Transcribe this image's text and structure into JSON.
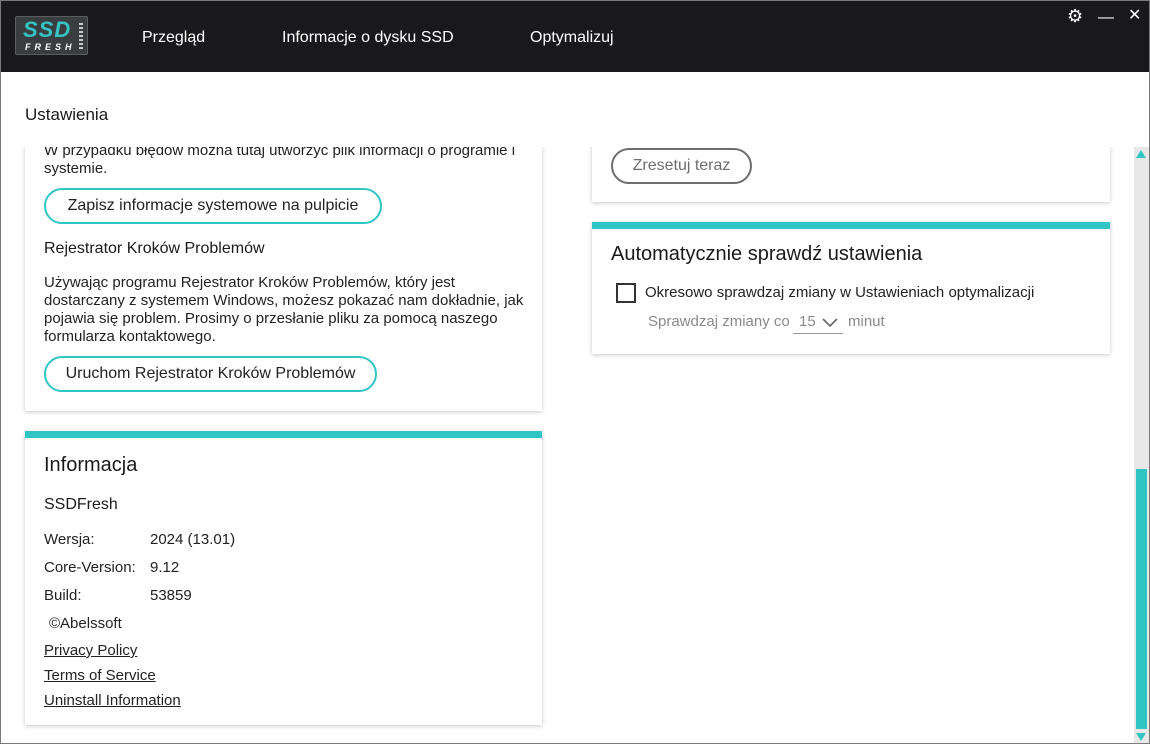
{
  "app": {
    "logo_main": "SSD",
    "logo_sub": "FRESH"
  },
  "nav": {
    "items": [
      {
        "label": "Przegląd"
      },
      {
        "label": "Informacje o dysku SSD"
      },
      {
        "label": "Optymalizuj"
      }
    ]
  },
  "window_controls": {
    "settings": "⚙",
    "minimize": "—",
    "close": "✕"
  },
  "page": {
    "title": "Ustawienia"
  },
  "support_card": {
    "intro_text": "W przypadku błędów można tutaj utworzyć plik informacji o programie i systemie.",
    "save_button": "Zapisz informacje systemowe na pulpicie",
    "psr_heading": "Rejestrator Kroków Problemów",
    "psr_text": "Używając programu Rejestrator Kroków Problemów, który jest dostarczany z systemem Windows, możesz pokazać nam dokładnie, jak pojawia się problem. Prosimy o przesłanie pliku za pomocą naszego formularza kontaktowego.",
    "psr_button": "Uruchom Rejestrator Kroków Problemów"
  },
  "info_card": {
    "title": "Informacja",
    "product": "SSDFresh",
    "rows": [
      {
        "label": "Wersja:",
        "value": "2024 (13.01)"
      },
      {
        "label": "Core-Version:",
        "value": "9.12"
      },
      {
        "label": "Build:",
        "value": "53859"
      }
    ],
    "copyright": "©Abelssoft",
    "links": [
      "Privacy Policy",
      "Terms of Service",
      "Uninstall Information"
    ]
  },
  "reset_card": {
    "button": "Zresetuj teraz"
  },
  "auto_check_card": {
    "title": "Automatycznie sprawdź ustawienia",
    "checkbox_label": "Okresowo sprawdzaj zmiany w Ustawieniach optymalizacji",
    "checked": false,
    "interval_prefix": "Sprawdzaj zmiany co",
    "interval_value": "15",
    "interval_suffix": "minut"
  },
  "colors": {
    "accent": "#30c5c5",
    "header_bg": "#19191b"
  }
}
